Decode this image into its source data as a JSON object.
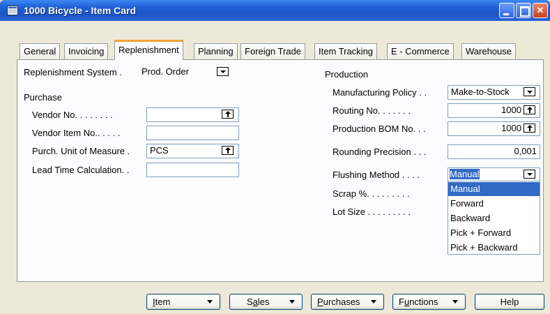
{
  "window": {
    "title": "1000 Bicycle - Item Card",
    "icon": "item-card-icon"
  },
  "tabs": [
    {
      "label": "General"
    },
    {
      "label": "Invoicing"
    },
    {
      "label": "Replenishment",
      "active": true
    },
    {
      "label": "Planning"
    },
    {
      "label": "Foreign Trade"
    },
    {
      "label": "Item Tracking"
    },
    {
      "label": "E - Commerce"
    },
    {
      "label": "Warehouse"
    }
  ],
  "left": {
    "replenishment_system": {
      "label": "Replenishment System .",
      "value": "Prod. Order"
    },
    "purchase_heading": "Purchase",
    "vendor_no": {
      "label": "Vendor No. . . . . . . .",
      "value": ""
    },
    "vendor_item_no": {
      "label": "Vendor Item No.. . . . .",
      "value": ""
    },
    "purch_uom": {
      "label": "Purch. Unit of Measure .",
      "value": "PCS"
    },
    "lead_time": {
      "label": "Lead Time Calculation. .",
      "value": ""
    }
  },
  "right": {
    "production_heading": "Production",
    "manufacturing_policy": {
      "label": "Manufacturing Policy . .",
      "value": "Make-to-Stock"
    },
    "routing_no": {
      "label": "Routing No. . . . . . .",
      "value": "1000"
    },
    "production_bom_no": {
      "label": "Production BOM No. . .",
      "value": "1000"
    },
    "rounding_precision": {
      "label": "Rounding Precision . . .",
      "value": "0,001"
    },
    "flushing_method": {
      "label": "Flushing Method . . . .",
      "value": "Manual"
    },
    "scrap": {
      "label": "Scrap %. . . . . . . . ."
    },
    "lot_size": {
      "label": "Lot Size . . . . . . . . ."
    }
  },
  "flushing_options": [
    "Manual",
    "Forward",
    "Backward",
    "Pick + Forward",
    "Pick + Backward"
  ],
  "flushing_selected_index": 0,
  "buttons": {
    "item": {
      "pre": "",
      "ul": "I",
      "post": "tem"
    },
    "sales": {
      "pre": "S",
      "ul": "a",
      "post": "les"
    },
    "purchases": {
      "pre": "",
      "ul": "P",
      "post": "urchases"
    },
    "functions": {
      "pre": "F",
      "ul": "u",
      "post": "nctions"
    },
    "help": "Help"
  },
  "colors": {
    "title_bar": "#1f5fd6",
    "selection": "#316ac5",
    "active_tab_accent": "#f2a33a",
    "background": "#ece9d8"
  }
}
